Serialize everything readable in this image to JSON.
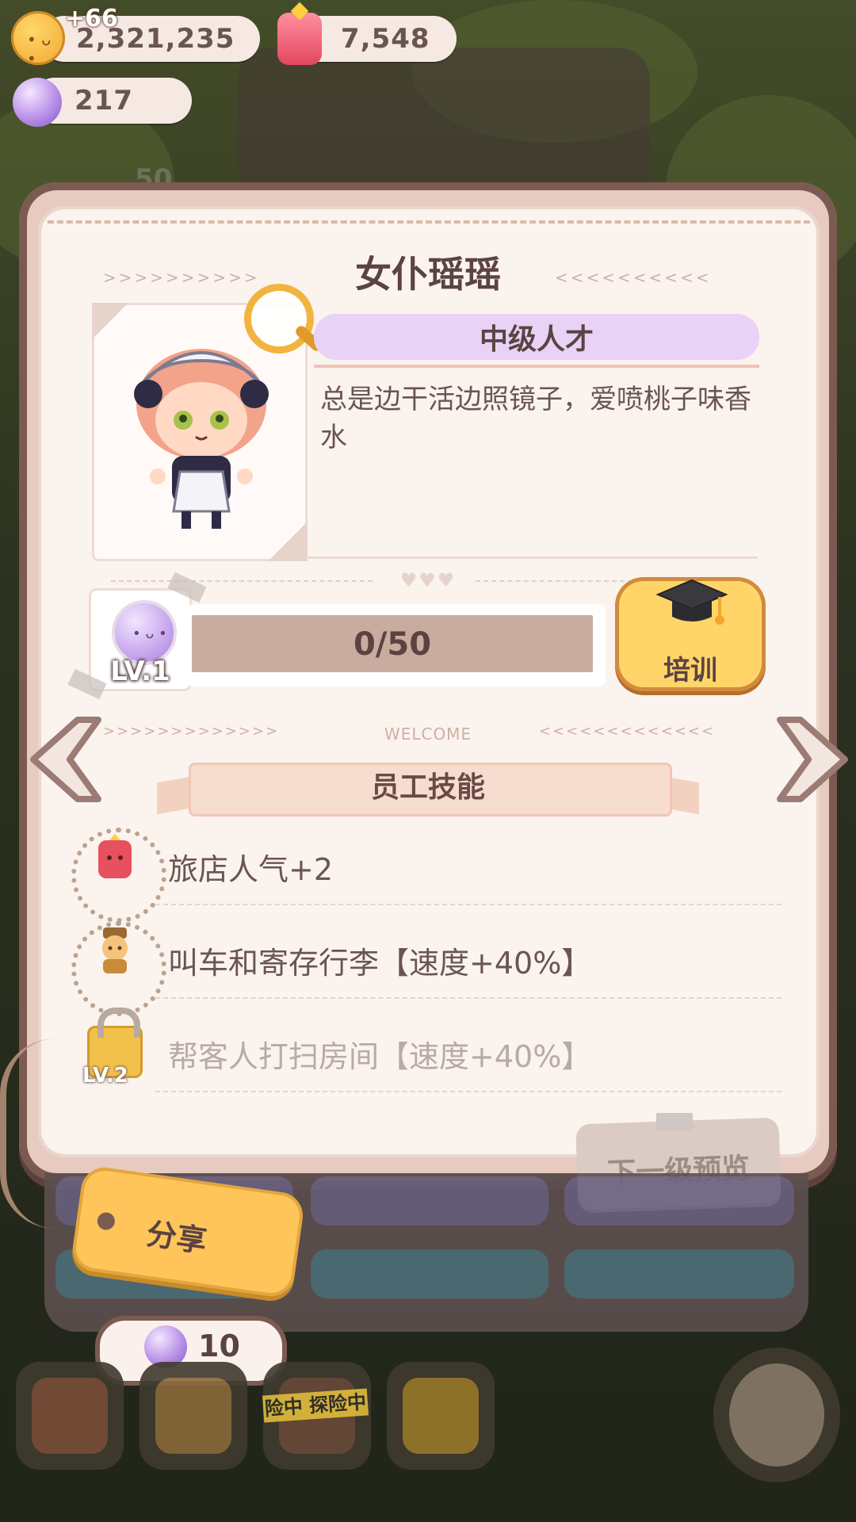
{
  "currency": {
    "coins": "2,321,235",
    "coins_gain": "+66",
    "popularity": "7,548",
    "gems": "217"
  },
  "hidden_bg": {
    "behind_number": "50"
  },
  "staff": {
    "name": "女仆瑶瑶",
    "rank": "中级人才",
    "description": "总是边干活边照镜子，爱喷桃子味香水",
    "level_label": "LV.1",
    "exp_text": "0/50",
    "exp_progress": 0,
    "train_label": "培训"
  },
  "divider": {
    "welcome": "WELCOME"
  },
  "skills_section": {
    "title": "员工技能",
    "skills": [
      {
        "icon": "candy-icon",
        "text": "旅店人气+2",
        "locked": false
      },
      {
        "icon": "bellhop-icon",
        "text": "叫车和寄存行李【速度+40%】",
        "locked": false
      },
      {
        "icon": "lock-icon",
        "text": "帮客人打扫房间【速度+40%】",
        "locked": true,
        "unlock_level": "LV.2"
      }
    ]
  },
  "actions": {
    "next_level_preview": "下一级预览",
    "share": "分享",
    "share_cost": "10"
  },
  "bottom_nav": {
    "explore_tape": "险中 探险中"
  },
  "colors": {
    "accent_yellow": "#ffd56a",
    "rank_purple": "#e8d3f6",
    "exp_bar": "#caaba0",
    "text_brown": "#5a4341"
  }
}
